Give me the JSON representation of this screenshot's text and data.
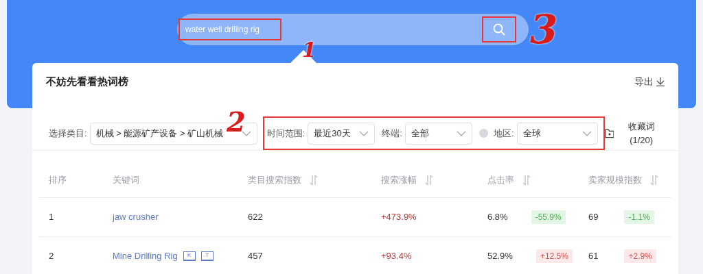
{
  "search": {
    "value": "water well drilling rig"
  },
  "annotations": [
    {
      "label": "1"
    },
    {
      "label": "2"
    },
    {
      "label": "3"
    }
  ],
  "card": {
    "title": "不妨先看看热词榜",
    "export": "导出"
  },
  "filters": {
    "category": {
      "label": "选择类目:",
      "value": "机械 > 能源矿产设备 > 矿山机械"
    },
    "time": {
      "label": "时间范围:",
      "value": "最近30天"
    },
    "terminal": {
      "label": "终端:",
      "value": "全部"
    },
    "region": {
      "label": "地区:",
      "value": "全球"
    },
    "favorites": "收藏词(1/20)"
  },
  "table": {
    "columns": [
      {
        "label": "排序",
        "sortable": false
      },
      {
        "label": "关键词",
        "sortable": false
      },
      {
        "label": "类目搜索指数",
        "sortable": true
      },
      {
        "label": "搜索涨幅",
        "sortable": true
      },
      {
        "label": "点击率",
        "sortable": true
      },
      {
        "label": "卖家规模指数",
        "sortable": true
      }
    ],
    "rows": [
      {
        "rank": "1",
        "keyword": "jaw crusher",
        "tags": [],
        "search_index": "622",
        "growth": "+473.9%",
        "ctr": "6.8%",
        "ctr_change": {
          "text": "-55.9%",
          "up": false
        },
        "sellers": "69",
        "sellers_change": {
          "text": "-1.1%",
          "up": false
        }
      },
      {
        "rank": "2",
        "keyword": "Mine Drilling Rig",
        "tags": [
          "K",
          "T"
        ],
        "search_index": "457",
        "growth": "+93.4%",
        "ctr": "52.9%",
        "ctr_change": {
          "text": "+12.5%",
          "up": true
        },
        "sellers": "61",
        "sellers_change": {
          "text": "+2.9%",
          "up": true
        }
      }
    ]
  }
}
